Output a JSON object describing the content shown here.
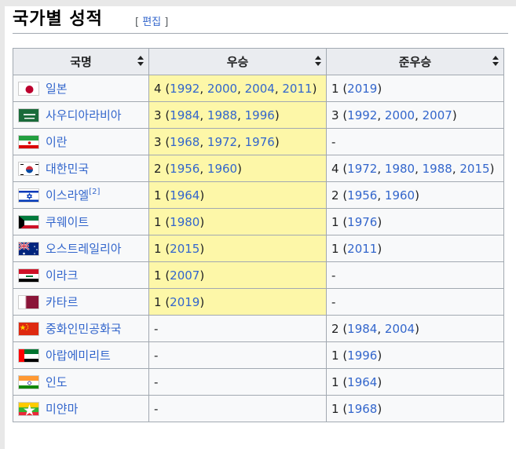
{
  "heading": {
    "title": "국가별 성적",
    "edit_open": "[ ",
    "edit_label": "편집",
    "edit_close": " ]"
  },
  "table": {
    "headers": [
      "국명",
      "우승",
      "준우승"
    ],
    "rows": [
      {
        "country": "일본",
        "flag": "japan-flag-icon",
        "win_count": "4",
        "win_years": [
          "1992",
          "2000",
          "2004",
          "2011"
        ],
        "runner_count": "1",
        "runner_years": [
          "2019"
        ]
      },
      {
        "country": "사우디아라비아",
        "flag": "saudi-arabia-flag-icon",
        "win_count": "3",
        "win_years": [
          "1984",
          "1988",
          "1996"
        ],
        "runner_count": "3",
        "runner_years": [
          "1992",
          "2000",
          "2007"
        ]
      },
      {
        "country": "이란",
        "flag": "iran-flag-icon",
        "win_count": "3",
        "win_years": [
          "1968",
          "1972",
          "1976"
        ],
        "runner_count": "-",
        "runner_years": []
      },
      {
        "country": "대한민국",
        "flag": "south-korea-flag-icon",
        "win_count": "2",
        "win_years": [
          "1956",
          "1960"
        ],
        "runner_count": "4",
        "runner_years": [
          "1972",
          "1980",
          "1988",
          "2015"
        ]
      },
      {
        "country": "이스라엘",
        "note": "[2]",
        "flag": "israel-flag-icon",
        "win_count": "1",
        "win_years": [
          "1964"
        ],
        "runner_count": "2",
        "runner_years": [
          "1956",
          "1960"
        ]
      },
      {
        "country": "쿠웨이트",
        "flag": "kuwait-flag-icon",
        "win_count": "1",
        "win_years": [
          "1980"
        ],
        "runner_count": "1",
        "runner_years": [
          "1976"
        ]
      },
      {
        "country": "오스트레일리아",
        "flag": "australia-flag-icon",
        "win_count": "1",
        "win_years": [
          "2015"
        ],
        "runner_count": "1",
        "runner_years": [
          "2011"
        ]
      },
      {
        "country": "이라크",
        "flag": "iraq-flag-icon",
        "win_count": "1",
        "win_years": [
          "2007"
        ],
        "runner_count": "-",
        "runner_years": []
      },
      {
        "country": "카타르",
        "flag": "qatar-flag-icon",
        "win_count": "1",
        "win_years": [
          "2019"
        ],
        "runner_count": "-",
        "runner_years": []
      },
      {
        "country": "중화인민공화국",
        "flag": "china-flag-icon",
        "win_count": "-",
        "win_years": [],
        "runner_count": "2",
        "runner_years": [
          "1984",
          "2004"
        ]
      },
      {
        "country": "아랍에미리트",
        "flag": "uae-flag-icon",
        "win_count": "-",
        "win_years": [],
        "runner_count": "1",
        "runner_years": [
          "1996"
        ]
      },
      {
        "country": "인도",
        "flag": "india-flag-icon",
        "win_count": "-",
        "win_years": [],
        "runner_count": "1",
        "runner_years": [
          "1964"
        ]
      },
      {
        "country": "미얀마",
        "flag": "myanmar-flag-icon",
        "win_count": "-",
        "win_years": [],
        "runner_count": "1",
        "runner_years": [
          "1968"
        ]
      }
    ]
  },
  "colors": {
    "link": "#3366cc",
    "win_bg": "#fdf7a8",
    "header_bg": "#eaecf0",
    "border": "#a2a9b1"
  }
}
